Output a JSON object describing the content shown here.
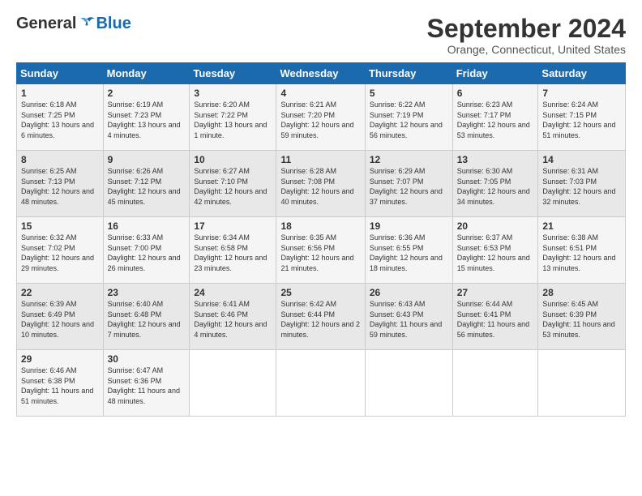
{
  "logo": {
    "general": "General",
    "blue": "Blue"
  },
  "title": "September 2024",
  "location": "Orange, Connecticut, United States",
  "days_of_week": [
    "Sunday",
    "Monday",
    "Tuesday",
    "Wednesday",
    "Thursday",
    "Friday",
    "Saturday"
  ],
  "weeks": [
    [
      {
        "day": "1",
        "sunrise": "6:18 AM",
        "sunset": "7:25 PM",
        "daylight": "13 hours and 6 minutes."
      },
      {
        "day": "2",
        "sunrise": "6:19 AM",
        "sunset": "7:23 PM",
        "daylight": "13 hours and 4 minutes."
      },
      {
        "day": "3",
        "sunrise": "6:20 AM",
        "sunset": "7:22 PM",
        "daylight": "13 hours and 1 minute."
      },
      {
        "day": "4",
        "sunrise": "6:21 AM",
        "sunset": "7:20 PM",
        "daylight": "12 hours and 59 minutes."
      },
      {
        "day": "5",
        "sunrise": "6:22 AM",
        "sunset": "7:19 PM",
        "daylight": "12 hours and 56 minutes."
      },
      {
        "day": "6",
        "sunrise": "6:23 AM",
        "sunset": "7:17 PM",
        "daylight": "12 hours and 53 minutes."
      },
      {
        "day": "7",
        "sunrise": "6:24 AM",
        "sunset": "7:15 PM",
        "daylight": "12 hours and 51 minutes."
      }
    ],
    [
      {
        "day": "8",
        "sunrise": "6:25 AM",
        "sunset": "7:13 PM",
        "daylight": "12 hours and 48 minutes."
      },
      {
        "day": "9",
        "sunrise": "6:26 AM",
        "sunset": "7:12 PM",
        "daylight": "12 hours and 45 minutes."
      },
      {
        "day": "10",
        "sunrise": "6:27 AM",
        "sunset": "7:10 PM",
        "daylight": "12 hours and 42 minutes."
      },
      {
        "day": "11",
        "sunrise": "6:28 AM",
        "sunset": "7:08 PM",
        "daylight": "12 hours and 40 minutes."
      },
      {
        "day": "12",
        "sunrise": "6:29 AM",
        "sunset": "7:07 PM",
        "daylight": "12 hours and 37 minutes."
      },
      {
        "day": "13",
        "sunrise": "6:30 AM",
        "sunset": "7:05 PM",
        "daylight": "12 hours and 34 minutes."
      },
      {
        "day": "14",
        "sunrise": "6:31 AM",
        "sunset": "7:03 PM",
        "daylight": "12 hours and 32 minutes."
      }
    ],
    [
      {
        "day": "15",
        "sunrise": "6:32 AM",
        "sunset": "7:02 PM",
        "daylight": "12 hours and 29 minutes."
      },
      {
        "day": "16",
        "sunrise": "6:33 AM",
        "sunset": "7:00 PM",
        "daylight": "12 hours and 26 minutes."
      },
      {
        "day": "17",
        "sunrise": "6:34 AM",
        "sunset": "6:58 PM",
        "daylight": "12 hours and 23 minutes."
      },
      {
        "day": "18",
        "sunrise": "6:35 AM",
        "sunset": "6:56 PM",
        "daylight": "12 hours and 21 minutes."
      },
      {
        "day": "19",
        "sunrise": "6:36 AM",
        "sunset": "6:55 PM",
        "daylight": "12 hours and 18 minutes."
      },
      {
        "day": "20",
        "sunrise": "6:37 AM",
        "sunset": "6:53 PM",
        "daylight": "12 hours and 15 minutes."
      },
      {
        "day": "21",
        "sunrise": "6:38 AM",
        "sunset": "6:51 PM",
        "daylight": "12 hours and 13 minutes."
      }
    ],
    [
      {
        "day": "22",
        "sunrise": "6:39 AM",
        "sunset": "6:49 PM",
        "daylight": "12 hours and 10 minutes."
      },
      {
        "day": "23",
        "sunrise": "6:40 AM",
        "sunset": "6:48 PM",
        "daylight": "12 hours and 7 minutes."
      },
      {
        "day": "24",
        "sunrise": "6:41 AM",
        "sunset": "6:46 PM",
        "daylight": "12 hours and 4 minutes."
      },
      {
        "day": "25",
        "sunrise": "6:42 AM",
        "sunset": "6:44 PM",
        "daylight": "12 hours and 2 minutes."
      },
      {
        "day": "26",
        "sunrise": "6:43 AM",
        "sunset": "6:43 PM",
        "daylight": "11 hours and 59 minutes."
      },
      {
        "day": "27",
        "sunrise": "6:44 AM",
        "sunset": "6:41 PM",
        "daylight": "11 hours and 56 minutes."
      },
      {
        "day": "28",
        "sunrise": "6:45 AM",
        "sunset": "6:39 PM",
        "daylight": "11 hours and 53 minutes."
      }
    ],
    [
      {
        "day": "29",
        "sunrise": "6:46 AM",
        "sunset": "6:38 PM",
        "daylight": "11 hours and 51 minutes."
      },
      {
        "day": "30",
        "sunrise": "6:47 AM",
        "sunset": "6:36 PM",
        "daylight": "11 hours and 48 minutes."
      },
      null,
      null,
      null,
      null,
      null
    ]
  ]
}
